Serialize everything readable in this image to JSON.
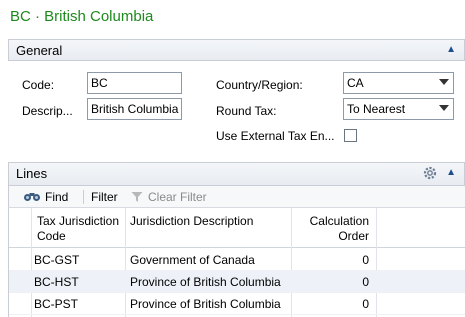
{
  "page": {
    "title": "BC · British Columbia"
  },
  "general": {
    "tab_label": "General",
    "code_label": "Code:",
    "code_value": "BC",
    "description_label": "Descrip...",
    "description_value": "British Columbia",
    "country_label": "Country/Region:",
    "country_value": "CA",
    "round_tax_label": "Round Tax:",
    "round_tax_value": "To Nearest",
    "use_external_label": "Use External Tax En...",
    "use_external_checked": false
  },
  "lines": {
    "tab_label": "Lines",
    "toolbar": {
      "find_label": "Find",
      "filter_label": "Filter",
      "clear_filter_label": "Clear Filter"
    },
    "columns": {
      "tax_jurisdiction_line1": "Tax Jurisdiction",
      "tax_jurisdiction_line2": "Code",
      "jurisdiction_description": "Jurisdiction Description",
      "calc_order_line1": "Calculation",
      "calc_order_line2": "Order"
    },
    "rows": [
      {
        "code": "BC-GST",
        "description": "Government of Canada",
        "order": "0"
      },
      {
        "code": "BC-HST",
        "description": "Province of British Columbia",
        "order": "0"
      },
      {
        "code": "BC-PST",
        "description": "Province of British Columbia",
        "order": "0"
      }
    ]
  },
  "colors": {
    "title_green": "#1e8a1e",
    "accent_blue": "#1f4e8c",
    "row_alt": "#eef2f8"
  },
  "icons": [
    "binoculars-icon",
    "clear-filter-icon",
    "gear-icon",
    "collapse-chevron-icon",
    "dropdown-arrow-icon"
  ]
}
